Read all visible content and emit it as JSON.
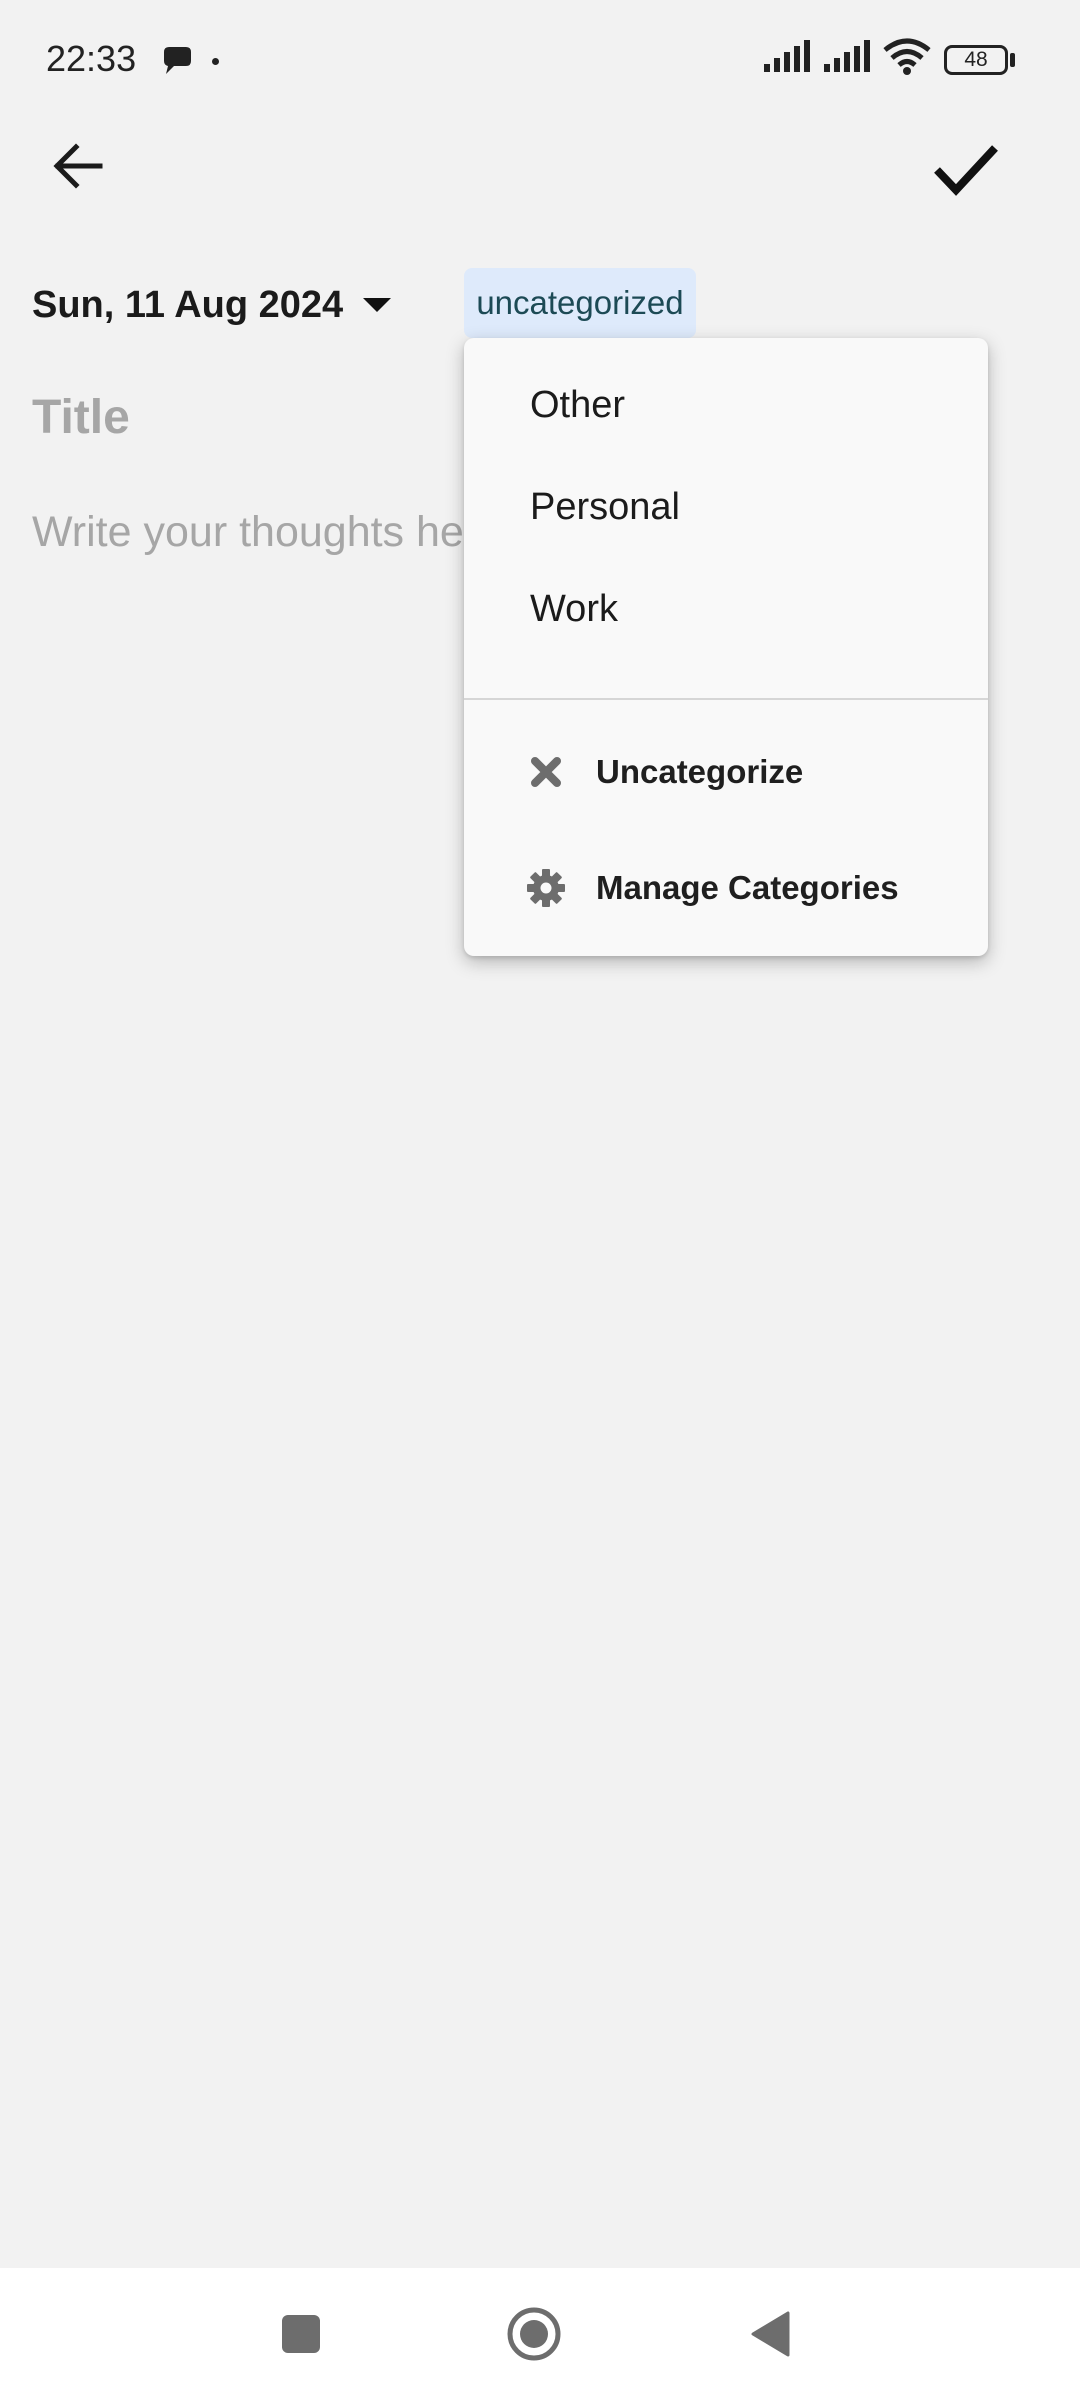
{
  "status_bar": {
    "time": "22:33",
    "battery": "48",
    "icons": [
      "chat-bubble-icon",
      "signal-icon",
      "signal-icon",
      "wifi-icon",
      "battery-icon"
    ]
  },
  "app_bar": {
    "back_icon": "arrow-left-icon",
    "confirm_icon": "check-icon"
  },
  "entry": {
    "date": "Sun, 11 Aug 2024",
    "category_chip": "uncategorized",
    "title_placeholder": "Title",
    "body_placeholder": "Write your thoughts he"
  },
  "category_menu": {
    "items": [
      {
        "label": "Other"
      },
      {
        "label": "Personal"
      },
      {
        "label": "Work"
      }
    ],
    "actions": [
      {
        "label": "Uncategorize",
        "icon": "close-icon"
      },
      {
        "label": "Manage Categories",
        "icon": "gear-icon"
      }
    ]
  },
  "nav_bar": {
    "icons": [
      "recents-square-icon",
      "home-circle-icon",
      "back-triangle-icon"
    ]
  },
  "colors": {
    "background": "#f2f2f2",
    "chip_bg": "#deeafb",
    "chip_text": "#1c4a55",
    "placeholder": "#a6a6a6",
    "menu_bg": "#f9f9f9"
  }
}
